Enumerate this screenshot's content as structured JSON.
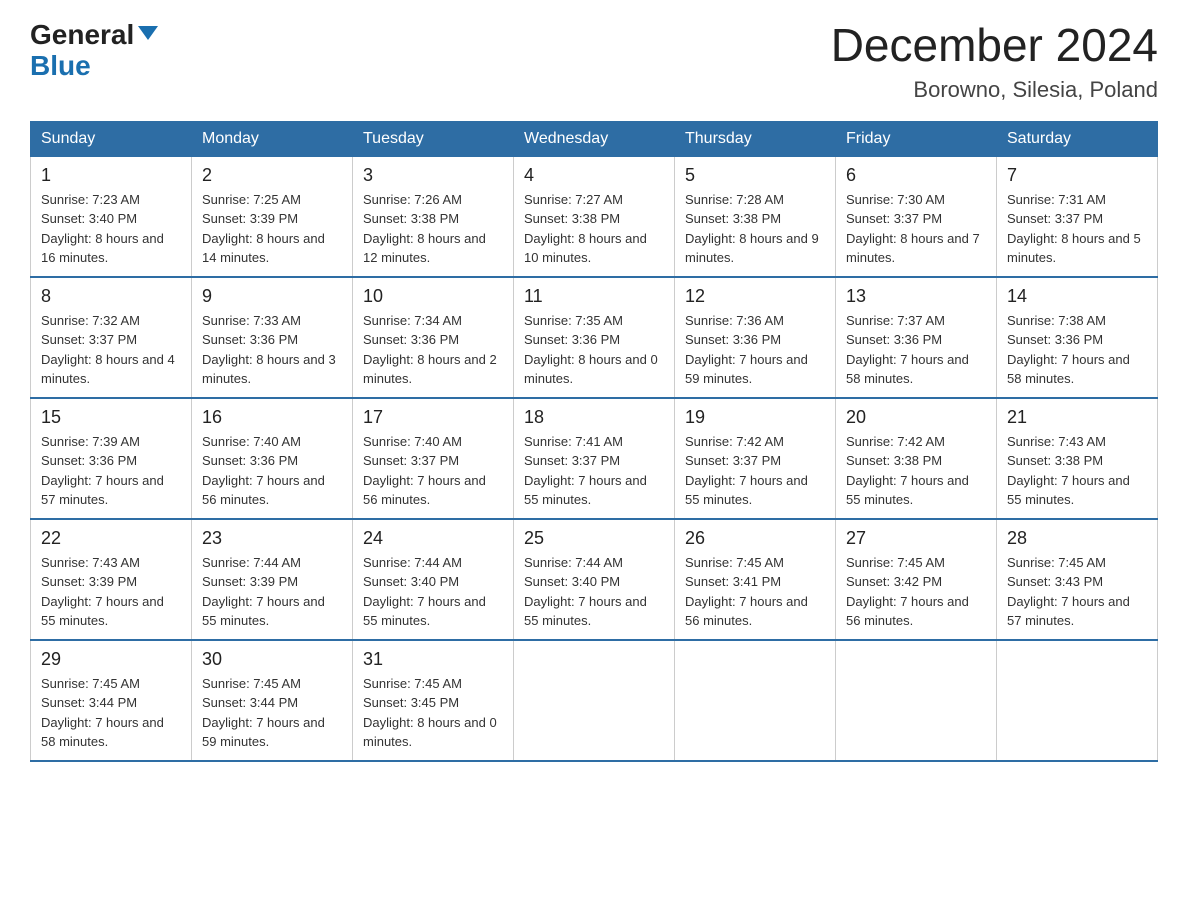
{
  "header": {
    "logo_general": "General",
    "logo_blue": "Blue",
    "month_title": "December 2024",
    "location": "Borowno, Silesia, Poland"
  },
  "days_of_week": [
    "Sunday",
    "Monday",
    "Tuesday",
    "Wednesday",
    "Thursday",
    "Friday",
    "Saturday"
  ],
  "weeks": [
    [
      {
        "day": "1",
        "sunrise": "7:23 AM",
        "sunset": "3:40 PM",
        "daylight": "8 hours and 16 minutes."
      },
      {
        "day": "2",
        "sunrise": "7:25 AM",
        "sunset": "3:39 PM",
        "daylight": "8 hours and 14 minutes."
      },
      {
        "day": "3",
        "sunrise": "7:26 AM",
        "sunset": "3:38 PM",
        "daylight": "8 hours and 12 minutes."
      },
      {
        "day": "4",
        "sunrise": "7:27 AM",
        "sunset": "3:38 PM",
        "daylight": "8 hours and 10 minutes."
      },
      {
        "day": "5",
        "sunrise": "7:28 AM",
        "sunset": "3:38 PM",
        "daylight": "8 hours and 9 minutes."
      },
      {
        "day": "6",
        "sunrise": "7:30 AM",
        "sunset": "3:37 PM",
        "daylight": "8 hours and 7 minutes."
      },
      {
        "day": "7",
        "sunrise": "7:31 AM",
        "sunset": "3:37 PM",
        "daylight": "8 hours and 5 minutes."
      }
    ],
    [
      {
        "day": "8",
        "sunrise": "7:32 AM",
        "sunset": "3:37 PM",
        "daylight": "8 hours and 4 minutes."
      },
      {
        "day": "9",
        "sunrise": "7:33 AM",
        "sunset": "3:36 PM",
        "daylight": "8 hours and 3 minutes."
      },
      {
        "day": "10",
        "sunrise": "7:34 AM",
        "sunset": "3:36 PM",
        "daylight": "8 hours and 2 minutes."
      },
      {
        "day": "11",
        "sunrise": "7:35 AM",
        "sunset": "3:36 PM",
        "daylight": "8 hours and 0 minutes."
      },
      {
        "day": "12",
        "sunrise": "7:36 AM",
        "sunset": "3:36 PM",
        "daylight": "7 hours and 59 minutes."
      },
      {
        "day": "13",
        "sunrise": "7:37 AM",
        "sunset": "3:36 PM",
        "daylight": "7 hours and 58 minutes."
      },
      {
        "day": "14",
        "sunrise": "7:38 AM",
        "sunset": "3:36 PM",
        "daylight": "7 hours and 58 minutes."
      }
    ],
    [
      {
        "day": "15",
        "sunrise": "7:39 AM",
        "sunset": "3:36 PM",
        "daylight": "7 hours and 57 minutes."
      },
      {
        "day": "16",
        "sunrise": "7:40 AM",
        "sunset": "3:36 PM",
        "daylight": "7 hours and 56 minutes."
      },
      {
        "day": "17",
        "sunrise": "7:40 AM",
        "sunset": "3:37 PM",
        "daylight": "7 hours and 56 minutes."
      },
      {
        "day": "18",
        "sunrise": "7:41 AM",
        "sunset": "3:37 PM",
        "daylight": "7 hours and 55 minutes."
      },
      {
        "day": "19",
        "sunrise": "7:42 AM",
        "sunset": "3:37 PM",
        "daylight": "7 hours and 55 minutes."
      },
      {
        "day": "20",
        "sunrise": "7:42 AM",
        "sunset": "3:38 PM",
        "daylight": "7 hours and 55 minutes."
      },
      {
        "day": "21",
        "sunrise": "7:43 AM",
        "sunset": "3:38 PM",
        "daylight": "7 hours and 55 minutes."
      }
    ],
    [
      {
        "day": "22",
        "sunrise": "7:43 AM",
        "sunset": "3:39 PM",
        "daylight": "7 hours and 55 minutes."
      },
      {
        "day": "23",
        "sunrise": "7:44 AM",
        "sunset": "3:39 PM",
        "daylight": "7 hours and 55 minutes."
      },
      {
        "day": "24",
        "sunrise": "7:44 AM",
        "sunset": "3:40 PM",
        "daylight": "7 hours and 55 minutes."
      },
      {
        "day": "25",
        "sunrise": "7:44 AM",
        "sunset": "3:40 PM",
        "daylight": "7 hours and 55 minutes."
      },
      {
        "day": "26",
        "sunrise": "7:45 AM",
        "sunset": "3:41 PM",
        "daylight": "7 hours and 56 minutes."
      },
      {
        "day": "27",
        "sunrise": "7:45 AM",
        "sunset": "3:42 PM",
        "daylight": "7 hours and 56 minutes."
      },
      {
        "day": "28",
        "sunrise": "7:45 AM",
        "sunset": "3:43 PM",
        "daylight": "7 hours and 57 minutes."
      }
    ],
    [
      {
        "day": "29",
        "sunrise": "7:45 AM",
        "sunset": "3:44 PM",
        "daylight": "7 hours and 58 minutes."
      },
      {
        "day": "30",
        "sunrise": "7:45 AM",
        "sunset": "3:44 PM",
        "daylight": "7 hours and 59 minutes."
      },
      {
        "day": "31",
        "sunrise": "7:45 AM",
        "sunset": "3:45 PM",
        "daylight": "8 hours and 0 minutes."
      },
      null,
      null,
      null,
      null
    ]
  ]
}
